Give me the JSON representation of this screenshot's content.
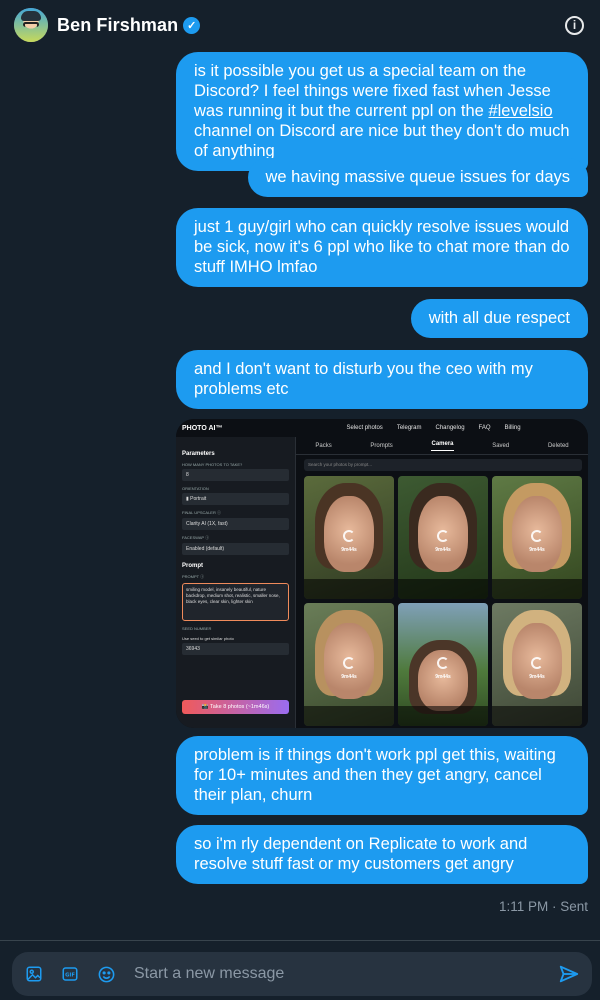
{
  "header": {
    "name": "Ben Firshman",
    "verified_mark": "✓",
    "info_icon": "info-icon"
  },
  "messages": [
    {
      "pre": "is it possible you get us a special team on the Discord? I feel things were fixed fast when Jesse was running it but the current ppl on the ",
      "link": "#levelsio",
      "post": " channel on Discord are nice but they don't do much of anything"
    },
    {
      "text": "we having massive queue issues for days"
    },
    {
      "text": "just 1 guy/girl who can quickly resolve issues would be sick, now it's 6 ppl who like to chat more than do stuff IMHO lmfao"
    },
    {
      "text": "with all due respect"
    },
    {
      "text": "and I don't want to disturb you the ceo with my problems etc"
    },
    {
      "text": "problem is if things don't work ppl get this, waiting for 10+ minutes and then they get angry, cancel their plan, churn"
    },
    {
      "text": "so i'm rly dependent on Replicate to work and resolve stuff fast or my customers get angry"
    }
  ],
  "attachment": {
    "brand": "PHOTO AI™",
    "nav": [
      "Select photos",
      "Telegram",
      "Changelog",
      "FAQ",
      "Billing"
    ],
    "sidebar": {
      "parameters": "Parameters",
      "how_many_label": "How many photos to take?",
      "how_many_value": "8",
      "orientation_label": "Orientation",
      "orientation_value": "▮ Portrait",
      "upscaler_label": "Final upscaler ⓘ",
      "upscaler_value": "Clarity AI (1X, fast)",
      "faceswap_label": "Faceswap ⓘ",
      "faceswap_value": "Enabled (default)",
      "prompt_section": "Prompt",
      "prompt_label": "Prompt ⓘ",
      "prompt_text": "smiling model, insanely beautiful, nature backdrop, medium shot, realistic, smaller nose, black eyes, clear skin, lighter skin",
      "seed_label": "Seed number",
      "seed_checkbox": "Use seed to get similar photo",
      "seed_value": "36943",
      "take_button": "📸 Take 8 photos (~1m46s)"
    },
    "tabs": [
      "Packs",
      "Prompts",
      "Camera",
      "Saved",
      "Deleted"
    ],
    "search_placeholder": "Search your photos by prompt...",
    "photo_times": [
      "9m44s",
      "9m44s",
      "9m44s",
      "9m44s",
      "9m44s",
      "9m44s"
    ]
  },
  "timestamp": "1:11 PM · Sent",
  "composer": {
    "placeholder": "Start a new message",
    "icons": [
      "image-icon",
      "gif-icon",
      "emoji-icon",
      "send-icon"
    ]
  },
  "colors": {
    "background": "#15202b",
    "bubble": "#1d9bf0",
    "accent": "#1d9bf0",
    "muted_text": "#8b98a5"
  }
}
